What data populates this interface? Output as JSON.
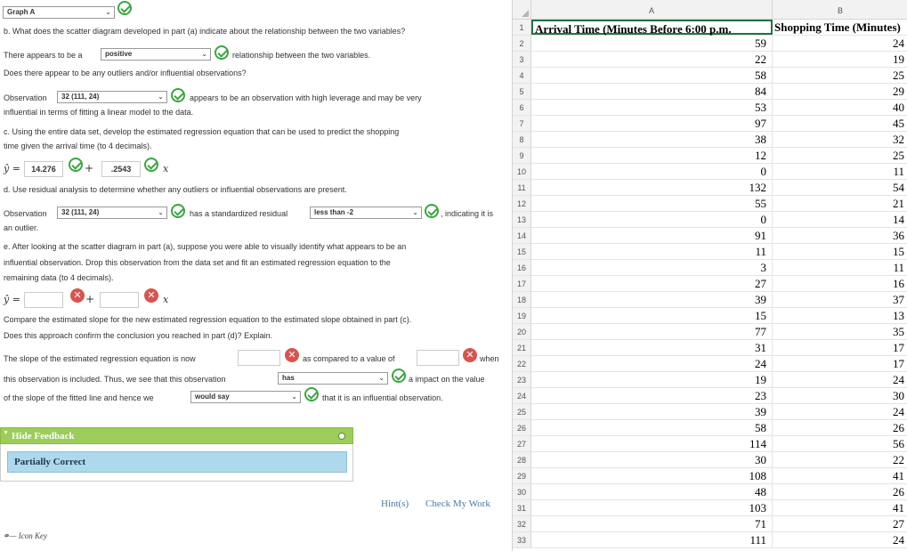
{
  "graph_select": "Graph A",
  "part_b": {
    "question": "b. What does the scatter diagram developed in part (a) indicate about the relationship between the two variables?",
    "pre": "There appears to be a",
    "select": "positive",
    "post": "relationship between the two variables.",
    "q2": "Does there appear to be any outliers and/or influential observations?",
    "obs_label": "Observation",
    "obs_select": "32 (111, 24)",
    "obs_post": "appears to be an observation with high leverage and may be very",
    "obs_post2": "influential in terms of fitting a linear model to the data."
  },
  "part_c": {
    "question_l1": "c. Using the entire data set, develop the estimated regression equation that can be used to predict the shopping",
    "question_l2": "time given the arrival time (to 4 decimals).",
    "yhat": "ŷ =",
    "intercept": "14.276",
    "plus": "+",
    "slope": ".2543",
    "x": "x"
  },
  "part_d": {
    "question": "d. Use residual analysis to determine whether any outliers or influential observations are present.",
    "obs_label": "Observation",
    "obs_select": "32 (111, 24)",
    "mid": "has a standardized residual",
    "resid_select": "less than -2",
    "post": ", indicating it is",
    "post2": "an outlier."
  },
  "part_e": {
    "q_l1": "e. After looking at the scatter diagram in part (a), suppose you were able to visually identify what appears to be an",
    "q_l2": "influential observation. Drop this observation from the data set and fit an estimated regression equation to the",
    "q_l3": "remaining data (to 4 decimals).",
    "yhat": "ŷ =",
    "plus": "+",
    "x": "x",
    "compare_l1": "Compare the estimated slope for the new estimated regression equation to the estimated slope obtained in part (c).",
    "compare_l2": "Does this approach confirm the conclusion you reached in part (d)? Explain.",
    "slope_now": "The slope of the estimated regression equation is now",
    "as_compared": "as compared to a value of",
    "when": "when",
    "included": "this observation is included. Thus, we see that this observation",
    "has_select": "has",
    "impact": "a impact on the value",
    "of_slope": "of the slope of the fitted line and hence we",
    "would_select": "would say",
    "influential": "that it is an influential observation."
  },
  "feedback": {
    "toggle": "Hide Feedback",
    "status": "Partially Correct"
  },
  "links": {
    "hints": "Hint(s)",
    "check": "Check My Work"
  },
  "icon_key": "Icon Key",
  "sheet": {
    "col_a": "A",
    "col_b": "B",
    "header_a": "Arrival Time (Minutes Before 6:00 p.m.",
    "header_b": "Shopping Time (Minutes)",
    "rows": [
      [
        59,
        24
      ],
      [
        22,
        19
      ],
      [
        58,
        25
      ],
      [
        84,
        29
      ],
      [
        53,
        40
      ],
      [
        97,
        45
      ],
      [
        38,
        32
      ],
      [
        12,
        25
      ],
      [
        0,
        11
      ],
      [
        132,
        54
      ],
      [
        55,
        21
      ],
      [
        0,
        14
      ],
      [
        91,
        36
      ],
      [
        11,
        15
      ],
      [
        3,
        11
      ],
      [
        27,
        16
      ],
      [
        39,
        37
      ],
      [
        15,
        13
      ],
      [
        77,
        35
      ],
      [
        31,
        17
      ],
      [
        24,
        17
      ],
      [
        19,
        24
      ],
      [
        23,
        30
      ],
      [
        39,
        24
      ],
      [
        58,
        26
      ],
      [
        114,
        56
      ],
      [
        30,
        22
      ],
      [
        108,
        41
      ],
      [
        48,
        26
      ],
      [
        103,
        41
      ],
      [
        71,
        27
      ],
      [
        111,
        24
      ]
    ]
  },
  "colors": {
    "correct": "#3aa640",
    "incorrect": "#d9534f",
    "feedback_bar": "#9ccc5a",
    "partial_box": "#aed8ec",
    "link": "#4a78a6"
  },
  "icons": [
    "check-icon",
    "x-icon",
    "caret-down-icon",
    "key-icon"
  ]
}
